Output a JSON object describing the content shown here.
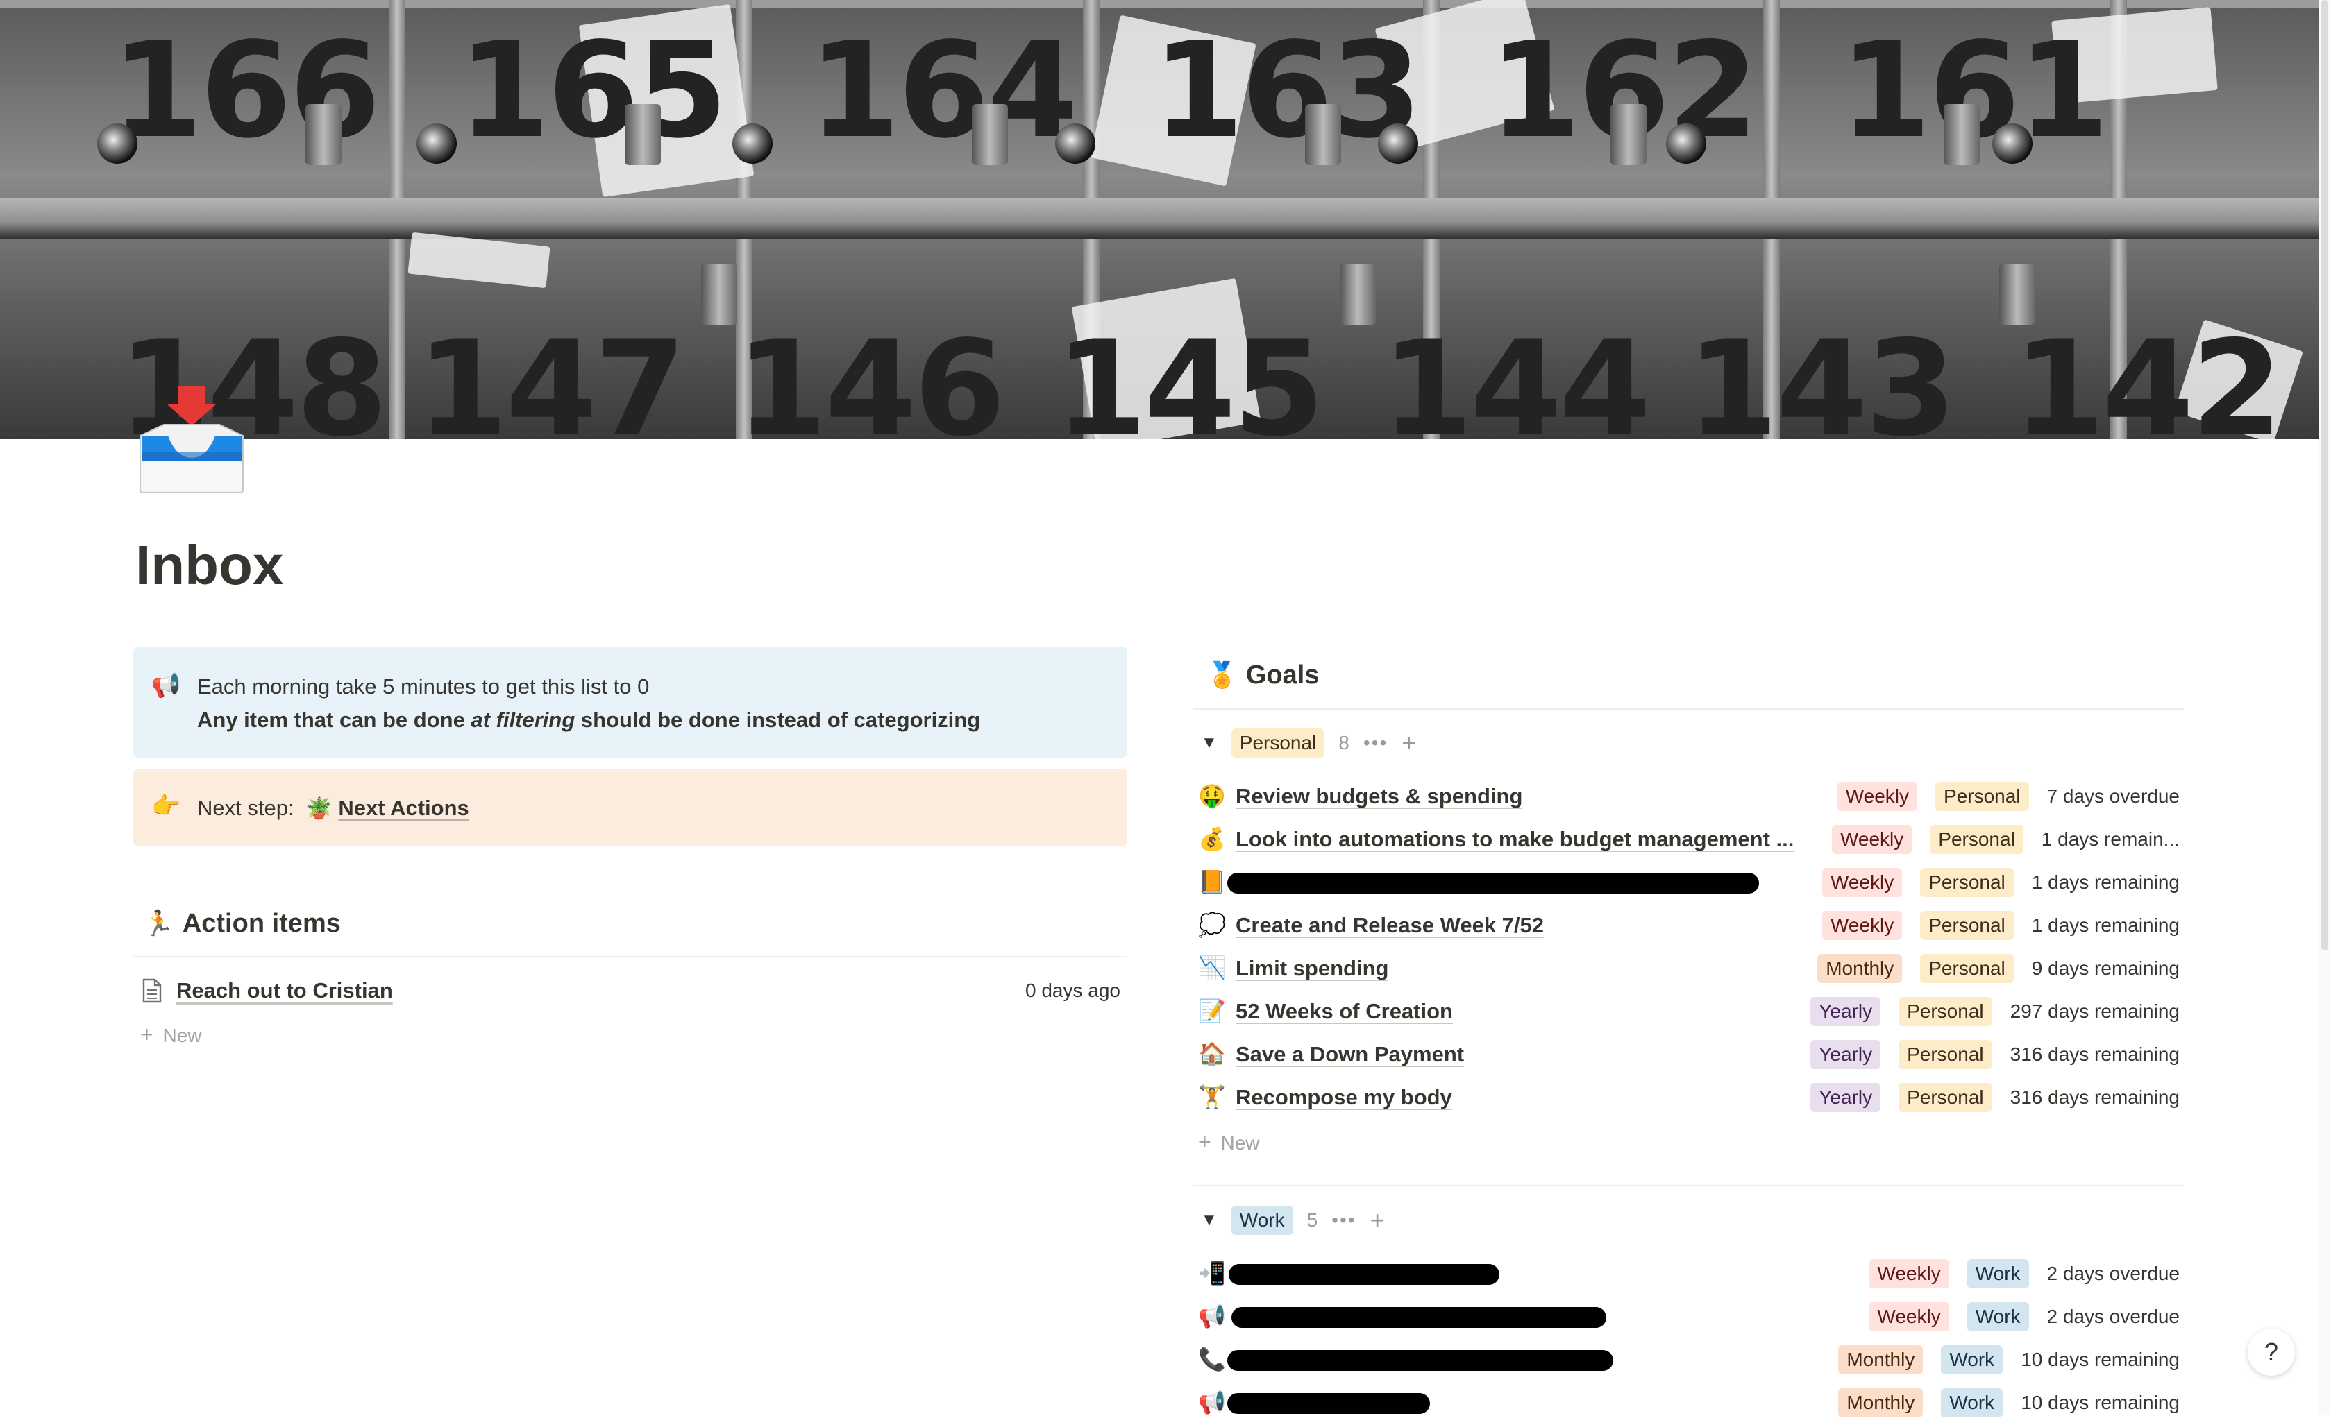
{
  "cover": {
    "numbers_top": [
      "166",
      "165",
      "164",
      "163",
      "162",
      "161"
    ],
    "numbers_bottom": [
      "148",
      "147",
      "146",
      "145",
      "144",
      "143",
      "142"
    ]
  },
  "page": {
    "icon": "inbox-tray-icon",
    "title": "Inbox"
  },
  "callout_info": {
    "icon": "megaphone-icon",
    "line1": "Each morning take 5 minutes to get this list to 0",
    "line2_pre": "Any item that can be done ",
    "line2_em": "at filtering",
    "line2_post": " should be done instead of categorizing"
  },
  "callout_next": {
    "icon": "pointing-hand-icon",
    "label": "Next step:",
    "link_icon": "potted-plant-icon",
    "link_text": "Next Actions"
  },
  "action_items": {
    "title": "Action items",
    "icon": "runner-icon",
    "items": [
      {
        "icon": "page-icon",
        "title": "Reach out to Cristian",
        "date": "0 days ago"
      }
    ],
    "new_label": "New"
  },
  "goals": {
    "title": "Goals",
    "icon": "medal-icon",
    "groups": [
      {
        "name": "Personal",
        "count": "8",
        "items": [
          {
            "icon": "money-face-icon",
            "title": "Review budgets & spending",
            "freq": "Weekly",
            "cat": "Personal",
            "status": "7 days overdue"
          },
          {
            "icon": "money-bag-icon",
            "title": "Look into automations to make budget management ...",
            "freq": "Weekly",
            "cat": "Personal",
            "status": "1 days remain..."
          },
          {
            "icon": "orange-book-icon",
            "title": "",
            "redacted": true,
            "freq": "Weekly",
            "cat": "Personal",
            "status": "1 days remaining"
          },
          {
            "icon": "thought-bubble-icon",
            "title": "Create and Release Week 7/52",
            "freq": "Weekly",
            "cat": "Personal",
            "status": "1 days remaining"
          },
          {
            "icon": "chart-down-icon",
            "title": "Limit spending",
            "freq": "Monthly",
            "cat": "Personal",
            "status": "9 days remaining"
          },
          {
            "icon": "memo-icon",
            "title": "52 Weeks of Creation",
            "freq": "Yearly",
            "cat": "Personal",
            "status": "297 days remaining"
          },
          {
            "icon": "house-icon",
            "title": "Save a Down Payment",
            "freq": "Yearly",
            "cat": "Personal",
            "status": "316 days remaining"
          },
          {
            "icon": "weightlifter-icon",
            "title": "Recompose my body",
            "freq": "Yearly",
            "cat": "Personal",
            "status": "316 days remaining"
          }
        ],
        "new_label": "New"
      },
      {
        "name": "Work",
        "count": "5",
        "items": [
          {
            "icon": "phone-arrow-icon",
            "title": "",
            "redacted": true,
            "freq": "Weekly",
            "cat": "Work",
            "status": "2 days overdue"
          },
          {
            "icon": "megaphone-icon",
            "title": "",
            "redacted": true,
            "freq": "Weekly",
            "cat": "Work",
            "status": "2 days overdue"
          },
          {
            "icon": "telephone-icon",
            "title": "",
            "redacted": true,
            "freq": "Monthly",
            "cat": "Work",
            "status": "10 days remaining"
          },
          {
            "icon": "megaphone-icon",
            "title": "",
            "redacted": true,
            "freq": "Monthly",
            "cat": "Work",
            "status": "10 days remaining"
          }
        ]
      }
    ]
  },
  "help": {
    "label": "?"
  },
  "colors": {
    "callout_blue": "#e7f3f8",
    "callout_orange": "#fbecdd",
    "tag_personal": "#fdecc8",
    "tag_work": "#d3e5ef",
    "tag_weekly": "#ffe2dd",
    "tag_monthly": "#fadec9",
    "tag_yearly": "#e8deee"
  }
}
